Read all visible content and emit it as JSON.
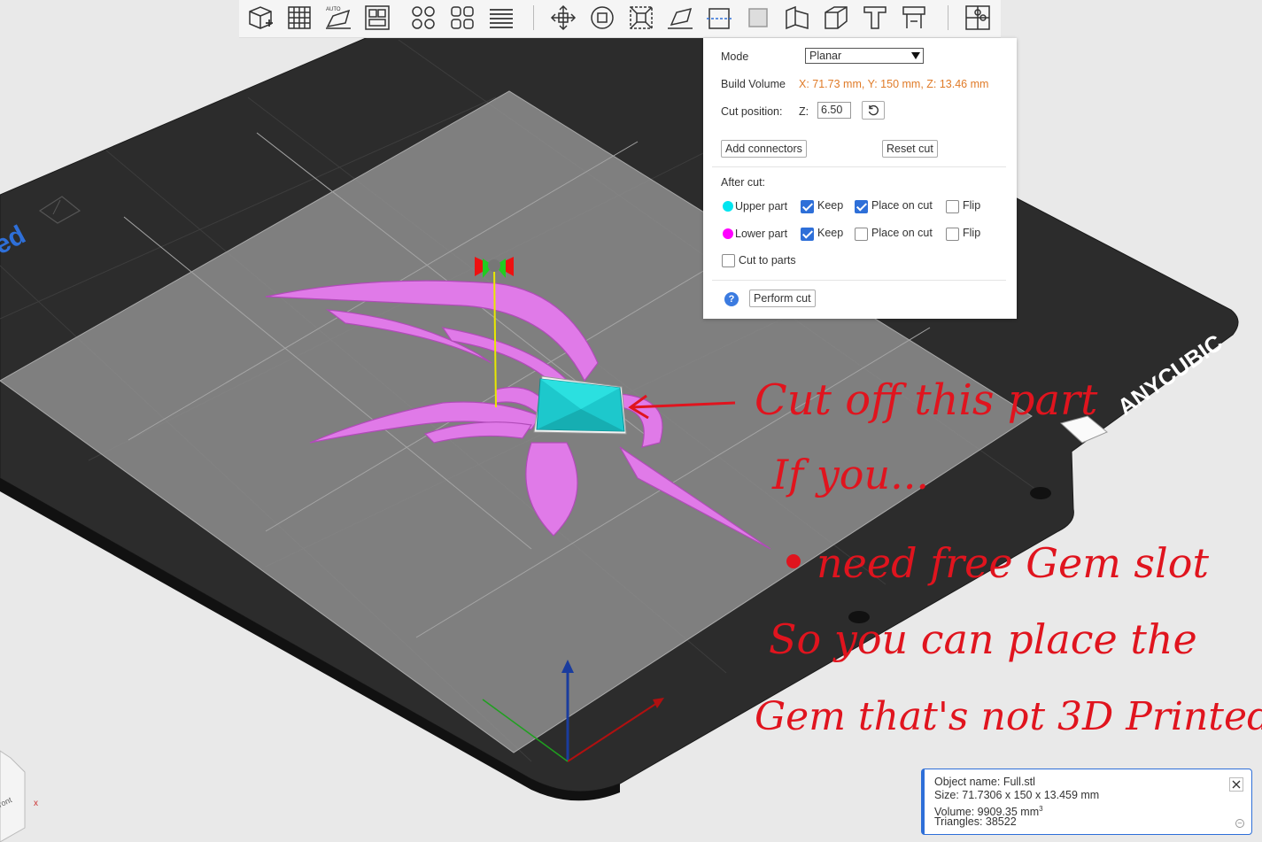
{
  "toolbar": {
    "tools": [
      {
        "name": "add-object-icon"
      },
      {
        "name": "arrange-grid-icon"
      },
      {
        "name": "auto-orient-icon",
        "badge": "AUTO"
      },
      {
        "name": "layout-plate-icon"
      },
      {
        "name": "multi-part-icon"
      },
      {
        "name": "split-parts-icon"
      },
      {
        "name": "layers-icon"
      },
      {
        "name": "move-tool-icon"
      },
      {
        "name": "rotate-tool-icon"
      },
      {
        "name": "scale-tool-icon"
      },
      {
        "name": "lay-on-face-icon"
      },
      {
        "name": "cut-tool-icon"
      },
      {
        "name": "support-paint-icon"
      },
      {
        "name": "seam-paint-icon"
      },
      {
        "name": "hollow-icon"
      },
      {
        "name": "text-tool-icon"
      },
      {
        "name": "measure-tool-icon"
      },
      {
        "name": "assembly-icon"
      }
    ]
  },
  "cut_panel": {
    "mode_label": "Mode",
    "mode_value": "Planar",
    "build_volume_label": "Build Volume",
    "build_volume_value": "X: 71.73 mm,  Y: 150 mm,  Z: 13.46 mm",
    "cut_position_label": "Cut position:",
    "z_label": "Z:",
    "z_value": "6.50",
    "add_connectors": "Add connectors",
    "reset_cut": "Reset cut",
    "after_cut_label": "After cut:",
    "upper_part": {
      "label": "Upper part",
      "color": "#00e5f0",
      "keep": "Keep",
      "keep_checked": true,
      "place_on_cut": "Place on cut",
      "place_checked": true,
      "flip": "Flip",
      "flip_checked": false
    },
    "lower_part": {
      "label": "Lower part",
      "color": "#ff00ff",
      "keep": "Keep",
      "keep_checked": true,
      "place_on_cut": "Place on cut",
      "place_checked": false,
      "flip": "Flip",
      "flip_checked": false
    },
    "cut_to_parts": "Cut to parts",
    "cut_to_parts_checked": false,
    "perform_cut": "Perform cut",
    "help": "?"
  },
  "object_info": {
    "name": "Object name: Full.stl",
    "size": "Size: 71.7306 x 150 x 13.459 mm",
    "volume": "Volume: 9909.35 mm",
    "volume_sup": "3",
    "triangles": "Triangles: 38522",
    "close": "✕",
    "minimize": "–"
  },
  "scene": {
    "bed_brand": "ANYCUBIC",
    "left_edge_text": "ed",
    "cube_face_label": "ront",
    "axis_x_label": "x",
    "gem_color": "#1dc8cc",
    "model_color": "#e07ae8"
  },
  "annotations": {
    "line1": "Cut off this part",
    "line2": "If you...",
    "line3": "need free Gem slot",
    "line4": "So you can place the",
    "line5": "Gem that's not 3D Printed",
    "color": "#e0141e"
  }
}
